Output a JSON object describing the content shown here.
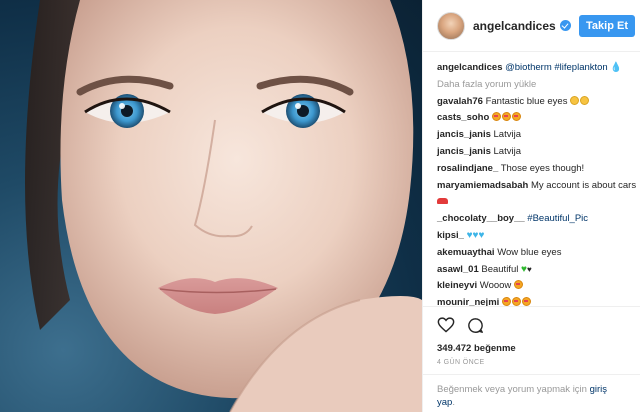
{
  "post": {
    "username": "angelcandices",
    "follow_label": "Takip Et",
    "caption": {
      "username": "angelcandices",
      "parts": [
        "@biotherm",
        "#lifeplankton"
      ],
      "emoji": "water-drop"
    },
    "load_more": "Daha fazla yorum yükle",
    "comments": [
      {
        "user": "gavalah76",
        "text": "Fantastic blue eyes"
      },
      {
        "user": "casts_soho",
        "text": ""
      },
      {
        "user": "jancis_janis",
        "text": "Latvija"
      },
      {
        "user": "jancis_janis",
        "text": "Latvija"
      },
      {
        "user": "rosalindjane_",
        "text": "Those eyes though!"
      },
      {
        "user": "maryamiemadsabah",
        "text": "My account is about cars"
      },
      {
        "user": "_chocolaty__boy__",
        "text": "#Beautiful_Pic"
      },
      {
        "user": "kipsi_",
        "text": ""
      },
      {
        "user": "akemuaythai",
        "text": "Wow blue eyes"
      },
      {
        "user": "asawl_01",
        "text": "Beautiful"
      },
      {
        "user": "kleineyvi",
        "text": "Wooow"
      },
      {
        "user": "mounir_nejmi",
        "text": ""
      }
    ],
    "likes": "349.472 beğenme",
    "time": "4 GÜN ÖNCE",
    "login_prompt": {
      "text": "Beğenmek veya yorum yapmak için",
      "link": "giriş yap",
      "suffix": "."
    }
  },
  "icons": {
    "like": "heart-outline-icon",
    "comment": "comment-bubble-icon",
    "verified": "verified-badge-icon"
  },
  "colors": {
    "accent": "#3897f0",
    "link": "#003569",
    "muted": "#999999",
    "text": "#262626"
  }
}
